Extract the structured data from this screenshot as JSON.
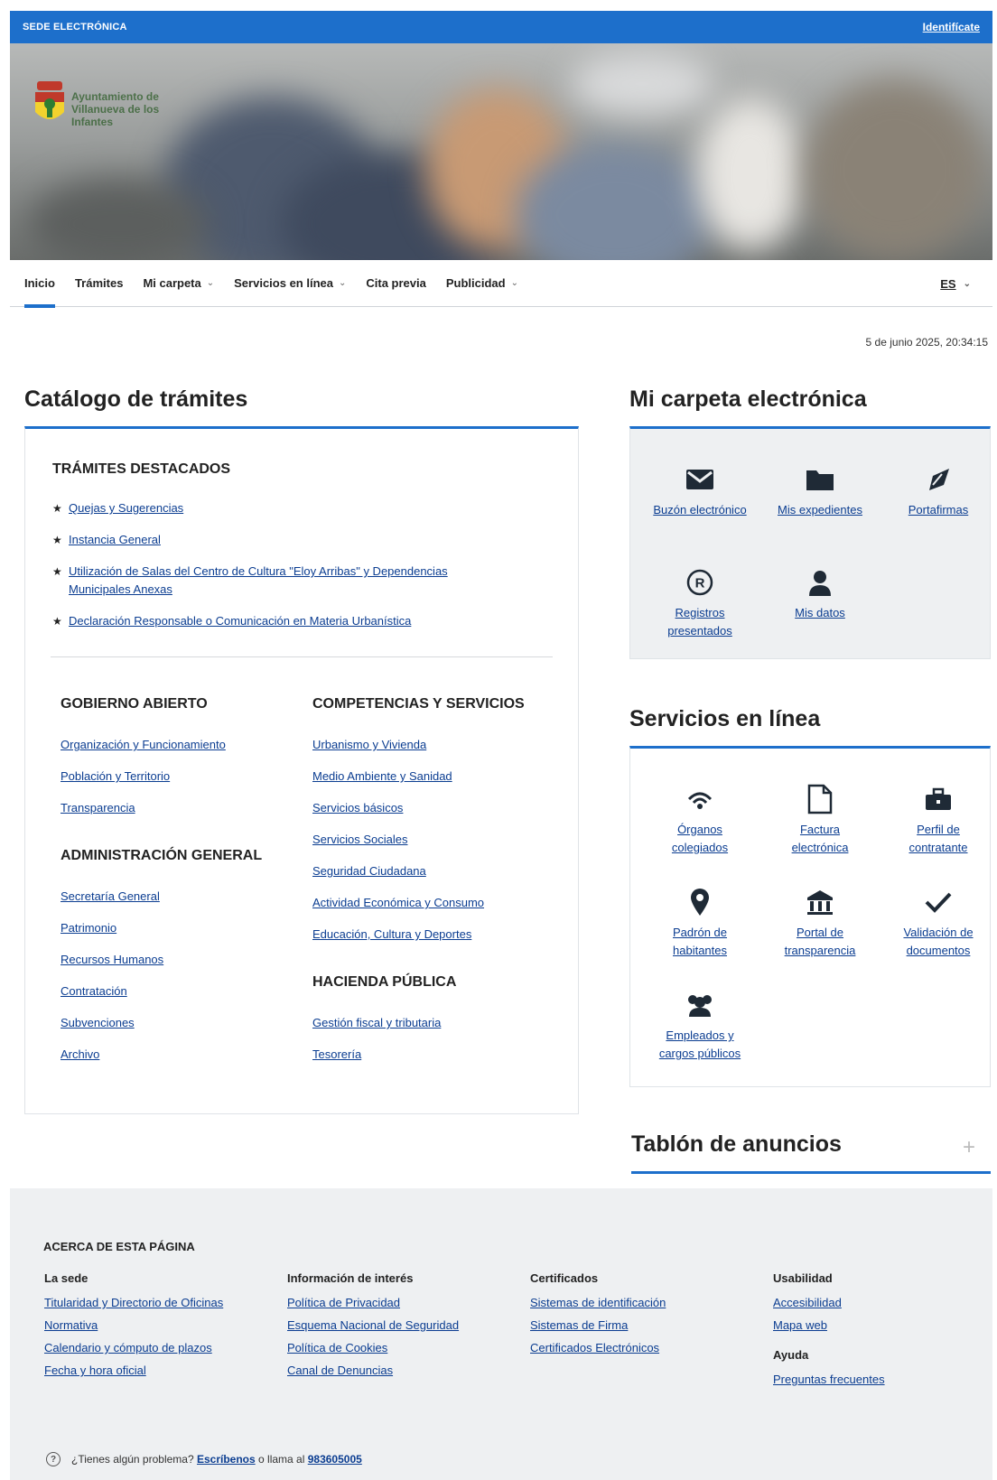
{
  "topbar": {
    "brand": "SEDE ELECTRÓNICA",
    "login": "Identifícate"
  },
  "hero": {
    "logo_text": "Ayuntamiento de Villanueva de los Infantes"
  },
  "nav": {
    "items": [
      {
        "label": "Inicio",
        "has_menu": false
      },
      {
        "label": "Trámites",
        "has_menu": false
      },
      {
        "label": "Mi carpeta",
        "has_menu": true
      },
      {
        "label": "Servicios en línea",
        "has_menu": true
      },
      {
        "label": "Cita previa",
        "has_menu": false
      },
      {
        "label": "Publicidad",
        "has_menu": true
      }
    ],
    "lang": "ES"
  },
  "datetime": "5 de junio 2025, 20:34:15",
  "catalog": {
    "title": "Catálogo de trámites",
    "featured_title": "TRÁMITES DESTACADOS",
    "featured": [
      "Quejas y Sugerencias",
      "Instancia General",
      "Utilización de Salas del Centro de Cultura \"Eloy Arribas\" y Dependencias Municipales Anexas",
      "Declaración Responsable o Comunicación en Materia Urbanística"
    ],
    "gobierno": {
      "title": "GOBIERNO ABIERTO",
      "links": [
        "Organización y Funcionamiento",
        "Población y Territorio",
        "Transparencia"
      ]
    },
    "administracion": {
      "title": "ADMINISTRACIÓN GENERAL",
      "links": [
        "Secretaría General",
        "Patrimonio",
        "Recursos Humanos",
        "Contratación",
        "Subvenciones",
        "Archivo"
      ]
    },
    "competencias": {
      "title": "COMPETENCIAS Y SERVICIOS",
      "links": [
        "Urbanismo y Vivienda",
        "Medio Ambiente y Sanidad",
        "Servicios básicos",
        "Servicios Sociales",
        "Seguridad Ciudadana",
        "Actividad Económica y Consumo",
        "Educación, Cultura y Deportes"
      ]
    },
    "hacienda": {
      "title": "HACIENDA PÚBLICA",
      "links": [
        "Gestión fiscal y tributaria",
        "Tesorería"
      ]
    }
  },
  "carpeta": {
    "title": "Mi carpeta electrónica",
    "tiles": [
      {
        "icon": "envelope-icon",
        "label": "Buzón electrónico"
      },
      {
        "icon": "folder-icon",
        "label": "Mis expedientes"
      },
      {
        "icon": "signature-icon",
        "label": "Portafirmas"
      },
      {
        "icon": "registered-icon",
        "label": "Registros presentados"
      },
      {
        "icon": "user-icon",
        "label": "Mis datos"
      }
    ]
  },
  "servicios": {
    "title": "Servicios en línea",
    "tiles": [
      {
        "icon": "signal-icon",
        "label": "Órganos colegiados"
      },
      {
        "icon": "document-icon",
        "label": "Factura electrónica"
      },
      {
        "icon": "briefcase-icon",
        "label": "Perfil de contratante"
      },
      {
        "icon": "map-pin-icon",
        "label": "Padrón de habitantes"
      },
      {
        "icon": "institution-icon",
        "label": "Portal de transparencia"
      },
      {
        "icon": "checkmark-icon",
        "label": "Validación de documentos"
      },
      {
        "icon": "people-icon",
        "label": "Empleados y cargos públicos"
      }
    ]
  },
  "tablon": {
    "title": "Tablón de anuncios",
    "expand": "+"
  },
  "footer": {
    "title": "ACERCA DE ESTA PÁGINA",
    "columns": [
      {
        "title": "La sede",
        "links": [
          "Titularidad y Directorio de Oficinas",
          "Normativa",
          "Calendario y cómputo de plazos",
          "Fecha y hora oficial"
        ]
      },
      {
        "title": "Información de interés",
        "links": [
          "Política de Privacidad",
          "Esquema Nacional de Seguridad",
          "Política de Cookies",
          "Canal de Denuncias"
        ]
      },
      {
        "title": "Certificados",
        "links": [
          "Sistemas de identificación",
          "Sistemas de Firma",
          "Certificados Electrónicos"
        ]
      },
      {
        "title": "Usabilidad",
        "links": [
          "Accesibilidad",
          "Mapa web"
        ]
      },
      {
        "title": "Ayuda",
        "links": [
          "Preguntas frecuentes"
        ]
      }
    ],
    "help": {
      "text1": "¿Tienes algún problema?",
      "link": "Escríbenos",
      "text2": "o llama al",
      "phone": "983605005"
    }
  },
  "colors": {
    "accent": "#1d6fcb",
    "link": "#0b3d91",
    "panel": "#eef0f2"
  }
}
